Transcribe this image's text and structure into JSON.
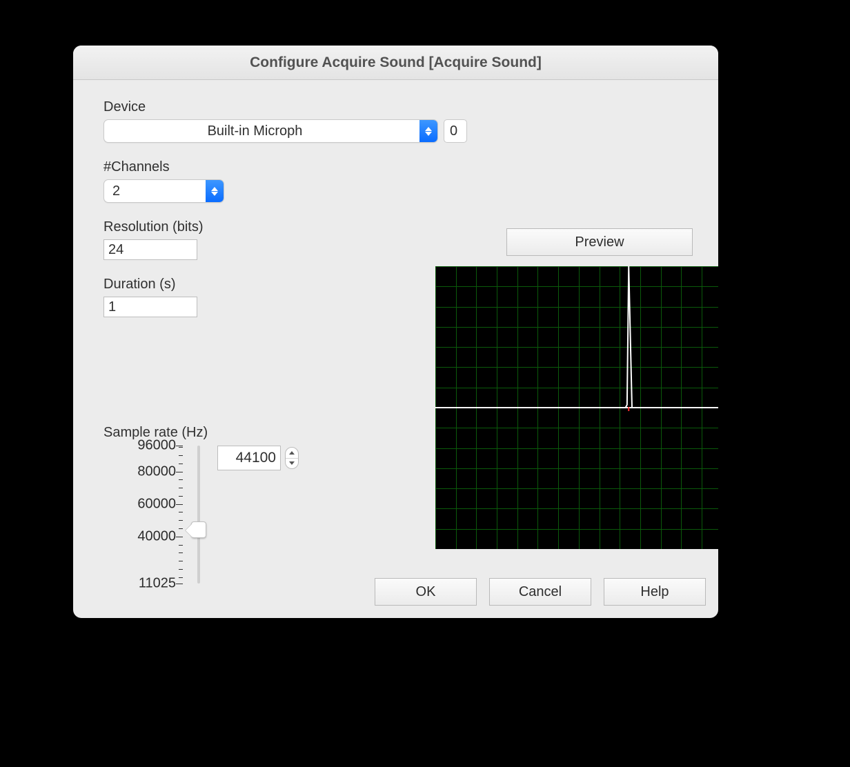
{
  "window": {
    "title": "Configure Acquire Sound [Acquire Sound]"
  },
  "device": {
    "label": "Device",
    "value": "Built-in Microph",
    "index": "0"
  },
  "channels": {
    "label": "#Channels",
    "value": "2"
  },
  "resolution": {
    "label": "Resolution (bits)",
    "value": "24"
  },
  "duration": {
    "label": "Duration (s)",
    "value": "1"
  },
  "sample_rate": {
    "label": "Sample rate (Hz)",
    "value": "44100",
    "min": 11025,
    "max": 96000,
    "scale_labels": [
      "96000",
      "80000",
      "60000",
      "40000",
      "11025"
    ]
  },
  "preview": {
    "button": "Preview"
  },
  "buttons": {
    "ok": "OK",
    "cancel": "Cancel",
    "help": "Help"
  },
  "chart_data": {
    "type": "line",
    "title": "",
    "xlabel": "",
    "ylabel": "",
    "xlim": [
      0,
      1
    ],
    "ylim": [
      -1,
      1
    ],
    "grid": true,
    "series": [
      {
        "name": "waveform",
        "x": [
          0.0,
          0.58,
          0.585,
          0.59,
          0.6,
          1.0
        ],
        "y": [
          0.0,
          0.0,
          0.02,
          1.0,
          0.0,
          0.0
        ]
      }
    ],
    "baseline_y": 0.0,
    "cursor_x": 0.59
  }
}
